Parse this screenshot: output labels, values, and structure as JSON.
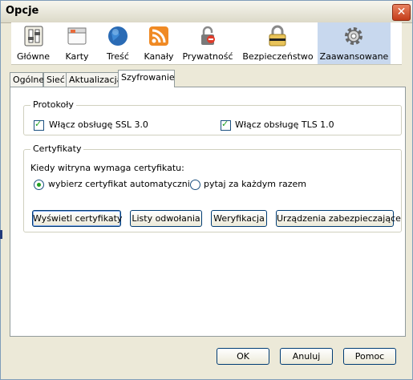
{
  "window": {
    "title": "Opcje",
    "close_symbol": "✕"
  },
  "toolbar": {
    "items": [
      {
        "label": "Główne",
        "icon": "general-switch-icon"
      },
      {
        "label": "Karty",
        "icon": "tabs-window-icon"
      },
      {
        "label": "Treść",
        "icon": "globe-icon"
      },
      {
        "label": "Kanały",
        "icon": "rss-icon"
      },
      {
        "label": "Prywatność",
        "icon": "privacy-mask-icon"
      },
      {
        "label": "Bezpieczeństwo",
        "icon": "padlock-icon"
      },
      {
        "label": "Zaawansowane",
        "icon": "gear-icon"
      }
    ],
    "selected": "Zaawansowane"
  },
  "tabs": [
    "Ogólne",
    "Sieć",
    "Aktualizacja",
    "Szyfrowanie"
  ],
  "active_tab": "Szyfrowanie",
  "protocols": {
    "legend": "Protokoły",
    "ssl_label": "Włącz obsługę SSL 3.0",
    "ssl_checked": true,
    "tls_label": "Włącz obsługę TLS 1.0",
    "tls_checked": true
  },
  "certificates": {
    "legend": "Certyfikaty",
    "prompt": "Kiedy witryna wymaga certyfikatu:",
    "option_auto": "wybierz certyfikat automatycznie",
    "option_ask": "pytaj za każdym razem",
    "selected_option": "wybierz certyfikat automatycznie",
    "buttons": {
      "view": "Wyświetl certyfikaty",
      "revocation": "Listy odwołania",
      "verification": "Weryfikacja",
      "devices": "Urządzenia zabezpieczające"
    }
  },
  "footer": {
    "ok": "OK",
    "cancel": "Anuluj",
    "help": "Pomoc"
  },
  "colors": {
    "selected_toolbar_bg": "#c8d8ee",
    "check_green": "#21a121",
    "close_red": "#c43c19"
  }
}
